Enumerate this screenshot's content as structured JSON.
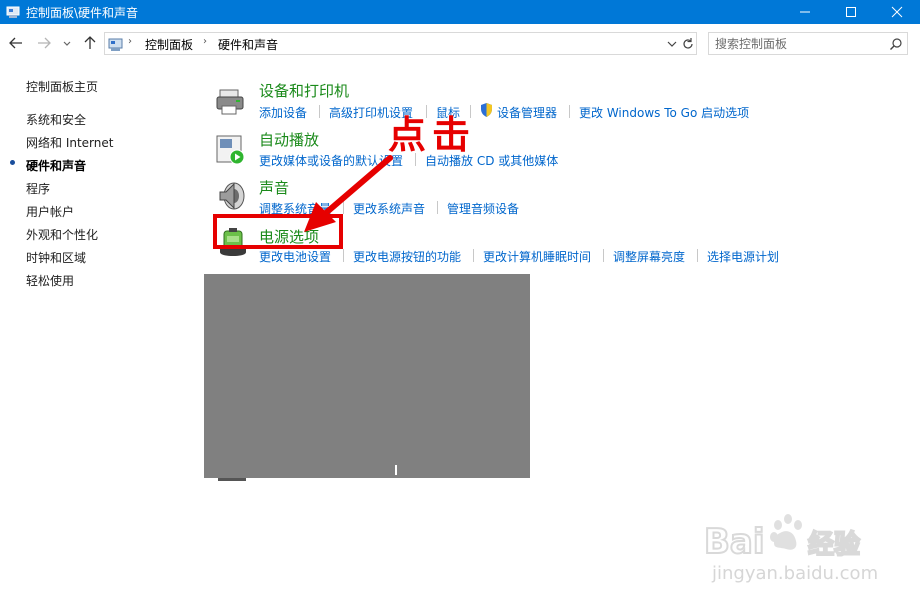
{
  "window": {
    "title": "控制面板\\硬件和声音",
    "controls": [
      "minimize",
      "maximize",
      "close"
    ]
  },
  "nav": {
    "back_icon": "arrow-left-icon",
    "forward_icon": "arrow-right-icon",
    "recent_icon": "chevron-down-icon",
    "up_icon": "arrow-up-icon"
  },
  "address": {
    "crumbs": [
      "控制面板",
      "硬件和声音"
    ]
  },
  "search": {
    "placeholder": "搜索控制面板"
  },
  "sidebar": {
    "home": "控制面板主页",
    "items": [
      {
        "label": "系统和安全",
        "current": false
      },
      {
        "label": "网络和 Internet",
        "current": false
      },
      {
        "label": "硬件和声音",
        "current": true
      },
      {
        "label": "程序",
        "current": false
      },
      {
        "label": "用户帐户",
        "current": false
      },
      {
        "label": "外观和个性化",
        "current": false
      },
      {
        "label": "时钟和区域",
        "current": false
      },
      {
        "label": "轻松使用",
        "current": false
      }
    ]
  },
  "categories": [
    {
      "title": "设备和打印机",
      "icon": "printer-icon",
      "links": [
        "添加设备",
        "高级打印机设置",
        "鼠标",
        "设备管理器",
        "更改 Windows To Go 启动选项"
      ]
    },
    {
      "title": "自动播放",
      "icon": "autoplay-icon",
      "links": [
        "更改媒体或设备的默认设置",
        "自动播放 CD 或其他媒体"
      ]
    },
    {
      "title": "声音",
      "icon": "speaker-icon",
      "links": [
        "调整系统音量",
        "更改系统声音",
        "管理音频设备"
      ]
    },
    {
      "title": "电源选项",
      "icon": "battery-icon",
      "links": [
        "更改电池设置",
        "更改电源按钮的功能",
        "更改计算机睡眠时间",
        "调整屏幕亮度",
        "选择电源计划"
      ]
    }
  ],
  "annotation": {
    "label": "点击",
    "color": "#e60000"
  },
  "watermark": {
    "brand": "Baidu经验",
    "url": "jingyan.baidu.com"
  },
  "colors": {
    "titlebar": "#0078d7",
    "category_title": "#1a8a1a",
    "link": "#0066cc"
  }
}
